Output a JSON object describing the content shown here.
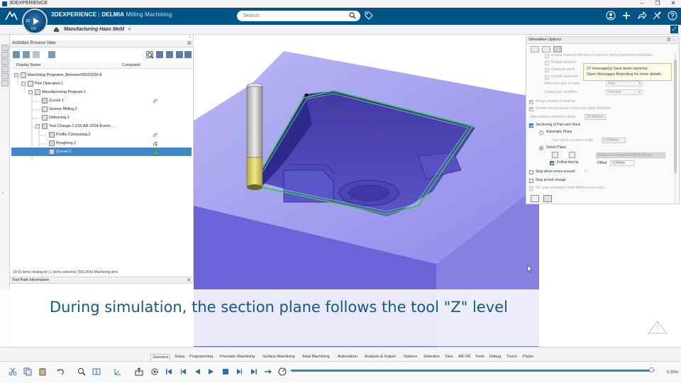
{
  "os": {
    "title": "3DEXPERIENCE",
    "min": "–",
    "max": "❐",
    "close": "✕"
  },
  "app": {
    "brand": "3DEXPERIENCE",
    "separator": " | ",
    "product": "DELMIA",
    "app_name": "Milling Machining",
    "compass_left": "3D",
    "compass_bottom": "V,R"
  },
  "search": {
    "placeholder": "Search"
  },
  "tabs": {
    "document": "Manufacturing Haas Mold",
    "add": "+"
  },
  "tree": {
    "panel_title": "Activities Process View",
    "columns": [
      "Display Name",
      "Computed"
    ],
    "rows": [
      {
        "label": "Machining Programs_Behavior00023256 A",
        "level": 0
      },
      {
        "label": "Part Operation.1",
        "level": 1
      },
      {
        "label": "Manufacturing Program.1",
        "level": 2
      },
      {
        "label": "ZLevel.1",
        "level": 3,
        "status": "computed"
      },
      {
        "label": "Groove Milling.2",
        "level": 3
      },
      {
        "label": "Deburring.1",
        "level": 3
      },
      {
        "label": "Tool Change.2 (ISCAR-2024-Event-...",
        "level": 3
      },
      {
        "label": "Profile Contouring.2",
        "level": 4,
        "status": "computed"
      },
      {
        "label": "Roughing.1",
        "level": 4,
        "status": "partial"
      },
      {
        "label": "ZLevel.2",
        "level": 4,
        "status": "active",
        "selected": true
      }
    ],
    "status_text": "10/10 items displayed | 1 items selected | 566,264s Machining time"
  },
  "tool_path": {
    "title": "Tool Path Information",
    "close": "✕"
  },
  "sim": {
    "title": "Simulation Options",
    "options": {
      "o1": "Enable material add back or remove during backward simulation",
      "o2": "Enable detailed",
      "o3": "Compute stock",
      "o4": "Enable automatic",
      "o5": "Select the part to keep",
      "o5_value": "Auto",
      "o6": "Cutting tool condition",
      "o6_value": "Nominal",
      "o7": "Merge clashes in fault list",
      "o8": "Enable sweep based continuous clash detection",
      "o9": "Max distance between steps",
      "o9_value": "10,000mm",
      "o10": "Sectioning of Part and Stock",
      "o11": "Automatic Plane",
      "o12": "Turn stock cut plane angle",
      "o12_value": "0,000deg",
      "o13": "Select Plane",
      "o13_value": "Physical Product00259826.1\\Face",
      "o14": "Follow tool tip",
      "o15": "Offset",
      "o15_value": "0,00mm",
      "o16": "Stop when errors exceed",
      "o16_value": "0",
      "o17": "Stop at tool change",
      "o18": "NC code simulation (with NMN license only)"
    }
  },
  "tooltip": {
    "line1": "27 message(s) have been reported.",
    "line2": "Open Messages Reporting for more details."
  },
  "caption": {
    "text": "During simulation, the section plane follows the tool \"Z\" level"
  },
  "workbench_tabs": [
    "Standard",
    "Setup",
    "Programming",
    "Prismatic Machining",
    "Surface Machining",
    "Axial Machining",
    "Automation",
    "Analysis & Output",
    "Options",
    "Selection",
    "View",
    "AR-VR",
    "Tools",
    "Debug",
    "Touch",
    "Player"
  ],
  "player": {
    "time": "0,165s",
    "progress": 0.99
  },
  "colors": {
    "brand": "#005386",
    "caption": "#0c5b8c",
    "part": "#6f6ad8",
    "toolpath": "#2ecc40",
    "selection": "#3f87c6"
  }
}
